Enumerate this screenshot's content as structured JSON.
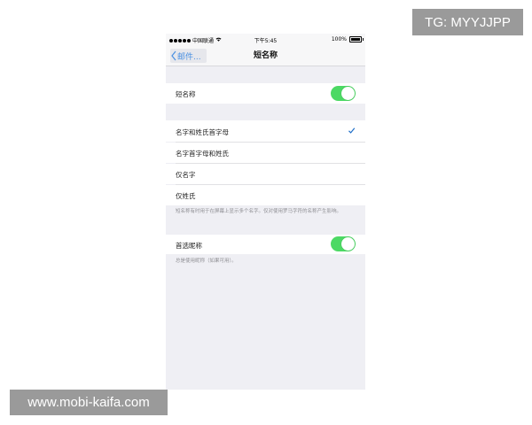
{
  "watermarks": {
    "top": "TG: MYYJJPP",
    "bottom": "www.mobi-kaifa.com"
  },
  "status_bar": {
    "carrier": "中国联通",
    "time": "下午5:45",
    "battery": "100%"
  },
  "nav": {
    "back_label": "邮件...",
    "title": "短名称"
  },
  "short_name": {
    "label": "短名称",
    "enabled": true
  },
  "options": [
    {
      "label": "名字和姓氏首字母",
      "selected": true
    },
    {
      "label": "名字首字母和姓氏",
      "selected": false
    },
    {
      "label": "仅名字",
      "selected": false
    },
    {
      "label": "仅姓氏",
      "selected": false
    }
  ],
  "options_footer": "短名称有时用于在屏幕上显示多个名字。仅对使用罗马字符的名称产生影响。",
  "nickname": {
    "label": "首选昵称",
    "enabled": true
  },
  "nickname_footer": "总是使用昵称（如果可用）。",
  "colors": {
    "accent": "#4a90e2",
    "toggle_on": "#4cd964",
    "background": "#efeff4",
    "check": "#1e6ec8"
  }
}
